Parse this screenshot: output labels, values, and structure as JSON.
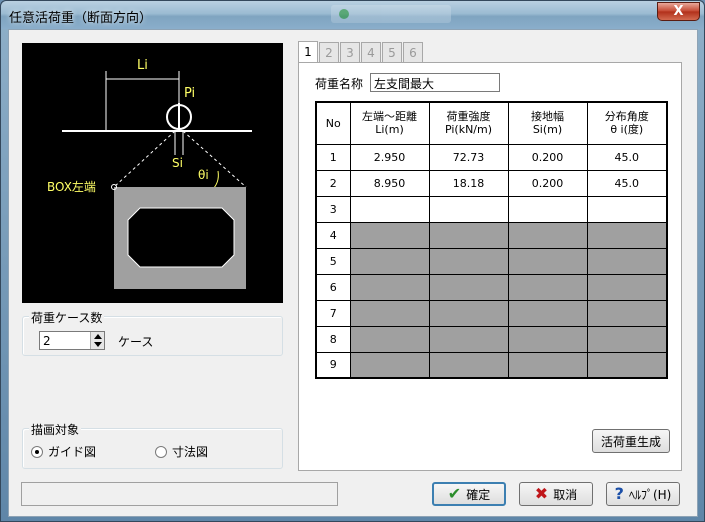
{
  "window": {
    "title": "任意活荷重（断面方向）",
    "close_glyph": "X"
  },
  "diagram": {
    "li": "Li",
    "pi": "Pi",
    "si": "Si",
    "theta": "θi",
    "box_left": "BOX左端"
  },
  "load_case_group": {
    "label": "荷重ケース数",
    "value": "2",
    "unit": "ケース"
  },
  "draw_target_group": {
    "label": "描画対象",
    "options": [
      {
        "label": "ガイド図",
        "selected": true
      },
      {
        "label": "寸法図",
        "selected": false
      }
    ]
  },
  "tabs": [
    "1",
    "2",
    "3",
    "4",
    "5",
    "6"
  ],
  "active_tab": 0,
  "load_name": {
    "label": "荷重名称",
    "value": "左支間最大"
  },
  "table": {
    "headers": [
      {
        "line1": "No",
        "line2": ""
      },
      {
        "line1": "左端～距離",
        "line2": "Li(m)"
      },
      {
        "line1": "荷重強度",
        "line2": "Pi(kN/m)"
      },
      {
        "line1": "接地幅",
        "line2": "Si(m)"
      },
      {
        "line1": "分布角度",
        "line2": "θ i(度)"
      }
    ],
    "rows": [
      {
        "no": "1",
        "li": "2.950",
        "pi": "72.73",
        "si": "0.200",
        "theta": "45.0",
        "state": "filled"
      },
      {
        "no": "2",
        "li": "8.950",
        "pi": "18.18",
        "si": "0.200",
        "theta": "45.0",
        "state": "filled"
      },
      {
        "no": "3",
        "li": "",
        "pi": "",
        "si": "",
        "theta": "",
        "state": "empty"
      },
      {
        "no": "4",
        "li": "",
        "pi": "",
        "si": "",
        "theta": "",
        "state": "disabled"
      },
      {
        "no": "5",
        "li": "",
        "pi": "",
        "si": "",
        "theta": "",
        "state": "disabled"
      },
      {
        "no": "6",
        "li": "",
        "pi": "",
        "si": "",
        "theta": "",
        "state": "disabled"
      },
      {
        "no": "7",
        "li": "",
        "pi": "",
        "si": "",
        "theta": "",
        "state": "disabled"
      },
      {
        "no": "8",
        "li": "",
        "pi": "",
        "si": "",
        "theta": "",
        "state": "disabled"
      },
      {
        "no": "9",
        "li": "",
        "pi": "",
        "si": "",
        "theta": "",
        "state": "disabled"
      }
    ]
  },
  "buttons": {
    "generate": "活荷重生成",
    "ok": "確定",
    "cancel": "取消",
    "help": "ﾍﾙﾌﾟ(H)"
  },
  "colors": {
    "preview_bg": "#000000",
    "diagram_line": "#ffffff",
    "diagram_label": "#ffff66",
    "box_fill": "#a0a0a0",
    "disabled_row": "#a0a0a0"
  }
}
